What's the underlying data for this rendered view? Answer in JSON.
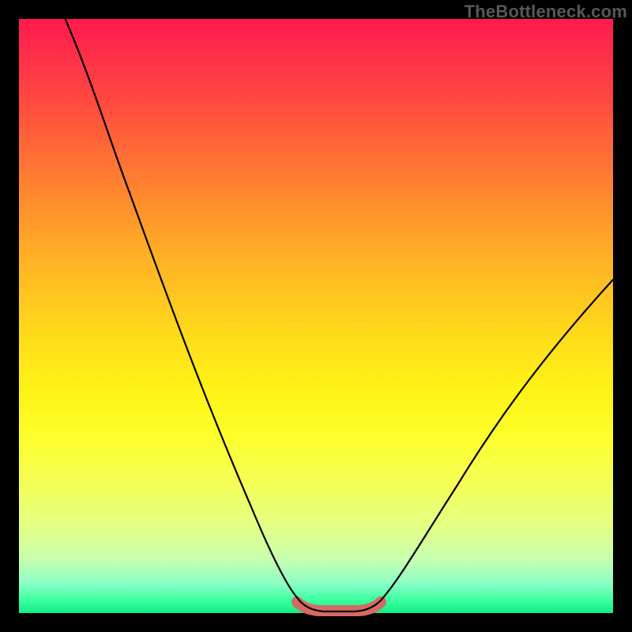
{
  "watermark": "TheBottleneck.com",
  "colors": {
    "frame": "#000000",
    "curve": "#000000",
    "optimal_band": "#d66a63",
    "gradient_top": "#ff1a4d",
    "gradient_bottom": "#13ec86"
  },
  "chart_data": {
    "type": "line",
    "title": "",
    "xlabel": "",
    "ylabel": "",
    "xlim": [
      0,
      100
    ],
    "ylim": [
      0,
      100
    ],
    "x": [
      0,
      5,
      10,
      15,
      20,
      25,
      30,
      35,
      40,
      45,
      47,
      50,
      53,
      55,
      57,
      60,
      65,
      70,
      75,
      80,
      85,
      90,
      95,
      100
    ],
    "values": [
      107,
      99,
      88,
      77,
      66,
      55,
      44,
      33,
      22,
      10,
      4,
      1,
      0,
      0,
      0,
      1,
      6,
      14,
      22,
      30,
      38,
      45,
      51,
      57
    ],
    "optimal_range_x": [
      47,
      59
    ],
    "notes": "V-shaped bottleneck curve over a vertical rainbow heat gradient. Values are percentages (0 = optimal, higher = worse). Left branch descends steeply from above the visible top edge; right branch ascends shallower. A thick salmon stroke marks the near-zero optimal band roughly between x=47 and x=59."
  }
}
